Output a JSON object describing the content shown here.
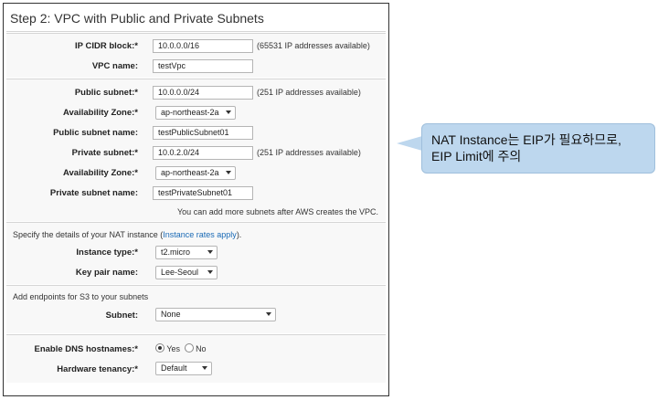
{
  "title": "Step 2: VPC with Public and Private Subnets",
  "vpc": {
    "cidr_label": "IP CIDR block:*",
    "cidr_value": "10.0.0.0/16",
    "cidr_note": "(65531 IP addresses available)",
    "name_label": "VPC name:",
    "name_value": "testVpc"
  },
  "subnets": {
    "public_label": "Public subnet:*",
    "public_value": "10.0.0.0/24",
    "public_note": "(251 IP addresses available)",
    "az1_label": "Availability Zone:*",
    "az1_value": "ap-northeast-2a",
    "public_name_label": "Public subnet name:",
    "public_name_value": "testPublicSubnet01",
    "private_label": "Private subnet:*",
    "private_value": "10.0.2.0/24",
    "private_note": "(251 IP addresses available)",
    "az2_label": "Availability Zone:*",
    "az2_value": "ap-northeast-2a",
    "private_name_label": "Private subnet name:",
    "private_name_value": "testPrivateSubnet01",
    "more_note": "You can add more subnets after AWS creates the VPC."
  },
  "nat": {
    "intro": "Specify the details of your NAT instance (",
    "link": "Instance rates apply",
    "intro_end": ").",
    "type_label": "Instance type:*",
    "type_value": "t2.micro",
    "key_label": "Key pair name:",
    "key_value": "Lee-Seoul"
  },
  "endpoints": {
    "intro": "Add endpoints for S3 to your subnets",
    "subnet_label": "Subnet:",
    "subnet_value": "None"
  },
  "dns": {
    "label": "Enable DNS hostnames:*",
    "yes": "Yes",
    "no": "No",
    "tenancy_label": "Hardware tenancy:*",
    "tenancy_value": "Default"
  },
  "callout": {
    "line1": "NAT Instance는 EIP가 필요하므로,",
    "line2": "EIP Limit에 주의"
  }
}
